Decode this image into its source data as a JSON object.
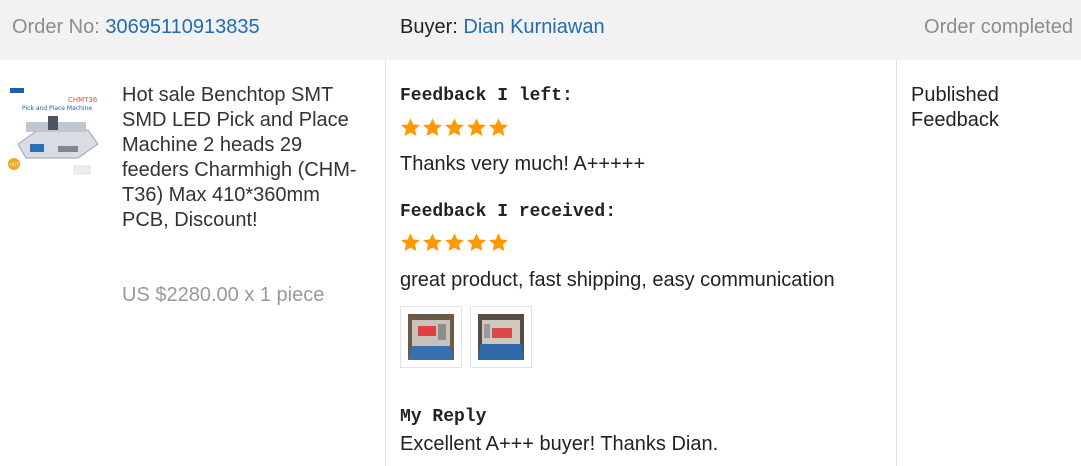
{
  "header": {
    "order_label": "Order No:",
    "order_number": "30695110913835",
    "buyer_label": "Buyer:",
    "buyer_name": "Dian Kurniawan",
    "status": "Order completed"
  },
  "product": {
    "thumbnail_label": "CHMT36",
    "thumbnail_sub": "Pick and Place Machine",
    "thumbnail_badge": "HOT",
    "title": "Hot sale Benchtop SMT SMD LED Pick and Place Machine 2 heads 29 feeders Charmhigh (CHM-T36) Max 410*360mm PCB, Discount!",
    "price": "US $2280.00 x 1 piece"
  },
  "feedback": {
    "left_label": "Feedback I left:",
    "left_rating": 5,
    "left_text": "Thanks very much! A+++++",
    "received_label": "Feedback I received:",
    "received_rating": 5,
    "received_text": "great product, fast shipping, easy communication",
    "photos": [
      "feedback-photo-1",
      "feedback-photo-2"
    ],
    "reply_label": "My Reply",
    "reply_text": "Excellent A+++ buyer! Thanks Dian."
  },
  "action": {
    "label": "Published Feedback"
  },
  "colors": {
    "link": "#1f6bb5",
    "star": "#ff9900",
    "header_bg": "#f2f2f2"
  }
}
